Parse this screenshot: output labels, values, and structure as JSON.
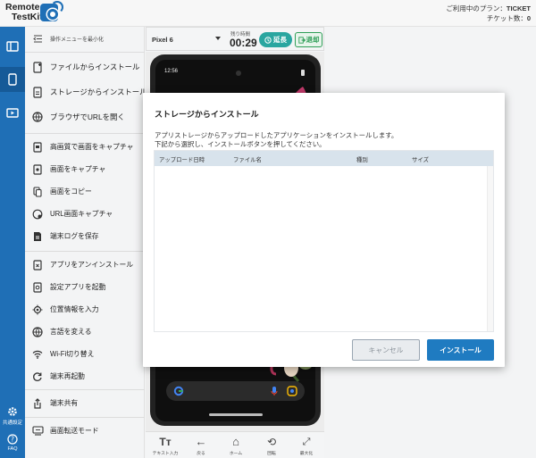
{
  "header": {
    "logo_line1": "Remote",
    "logo_line2": "TestKit",
    "plan_label": "ご利用中のプラン：",
    "plan_value": "TICKET",
    "tickets_label": "チケット数：",
    "tickets_value": "0"
  },
  "nav": {
    "settings_label": "共通設定",
    "faq_label": "FAQ"
  },
  "menu": {
    "minimize": "操作メニューを最小化",
    "install_file": "ファイルからインストール",
    "install_storage": "ストレージからインストール",
    "open_url": "ブラウザでURLを開く",
    "hq_capture": "高画質で画面をキャプチャ",
    "capture": "画面をキャプチャ",
    "copy_screen": "画面をコピー",
    "url_capture": "URL画面キャプチャ",
    "save_log": "端末ログを保存",
    "uninstall": "アプリをアンインストール",
    "settings_app": "設定アプリを起動",
    "location": "位置情報を入力",
    "language": "言語を変える",
    "wifi": "Wi-Fi切り替え",
    "reboot": "端末再起動",
    "share": "端末共有",
    "transfer_mode": "画面転送モード"
  },
  "device": {
    "name": "Pixel 6",
    "remaining_label": "残り時間",
    "time": "00:29",
    "extend_label": "延長",
    "exit_label": "退却",
    "clock": "12:56"
  },
  "toolbar": {
    "text_input": "テキスト入力",
    "back": "戻る",
    "home": "ホーム",
    "rotate": "回転",
    "zoom": "最大化"
  },
  "modal": {
    "title": "ストレージからインストール",
    "desc_line1": "アプリストレージからアップロードしたアプリケーションをインストールします。",
    "desc_line2": "下記から選択し、インストールボタンを押してください。",
    "columns": [
      "アップロード日時",
      "ファイル名",
      "種別",
      "サイズ"
    ],
    "rows": [],
    "cancel_label": "キャンセル",
    "install_label": "インストール"
  },
  "colors": {
    "nav_blue": "#1f6fb6",
    "install_blue": "#1f7bc1",
    "extend_teal": "#2aa6a0",
    "exit_green": "#2f9e57",
    "table_header": "#d8e3ec"
  }
}
